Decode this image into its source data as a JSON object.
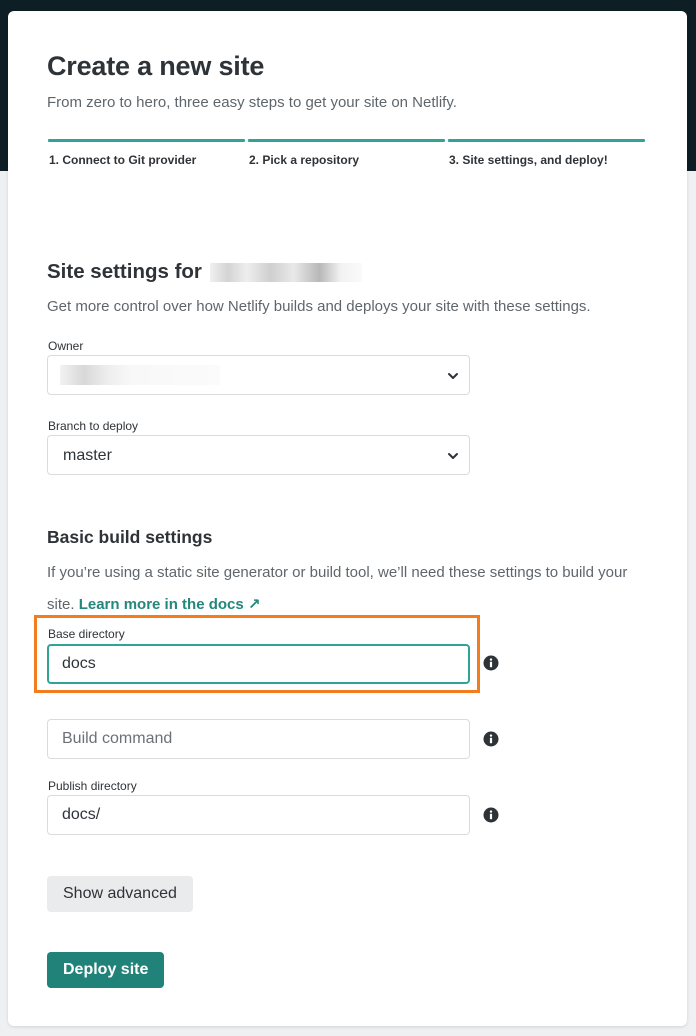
{
  "header": {
    "title": "Create a new site",
    "subtitle": "From zero to hero, three easy steps to get your site on Netlify."
  },
  "steps": [
    {
      "label": "1. Connect to Git provider"
    },
    {
      "label": "2. Pick a repository"
    },
    {
      "label": "3. Site settings, and deploy!"
    }
  ],
  "site_settings": {
    "title_prefix": "Site settings for",
    "description": "Get more control over how Netlify builds and deploys your site with these settings."
  },
  "owner": {
    "label": "Owner"
  },
  "branch": {
    "label": "Branch to deploy",
    "value": "master"
  },
  "build_settings": {
    "title": "Basic build settings",
    "description": "If you’re using a static site generator or build tool, we’ll need these settings to build your site.",
    "docs_link": "Learn more in the docs ↗"
  },
  "base_directory": {
    "label": "Base directory",
    "value": "docs"
  },
  "build_command": {
    "placeholder": "Build command"
  },
  "publish_directory": {
    "label": "Publish directory",
    "value": "docs/"
  },
  "buttons": {
    "show_advanced": "Show advanced",
    "deploy": "Deploy site"
  },
  "colors": {
    "accent": "#30a397",
    "primary_button": "#208279",
    "highlight": "#f47c1c",
    "header_background": "#0e1e25"
  },
  "icons": {
    "select_chevron": "chevron-down-icon",
    "field_help": "info-icon",
    "external_link": "arrow-up-right"
  }
}
